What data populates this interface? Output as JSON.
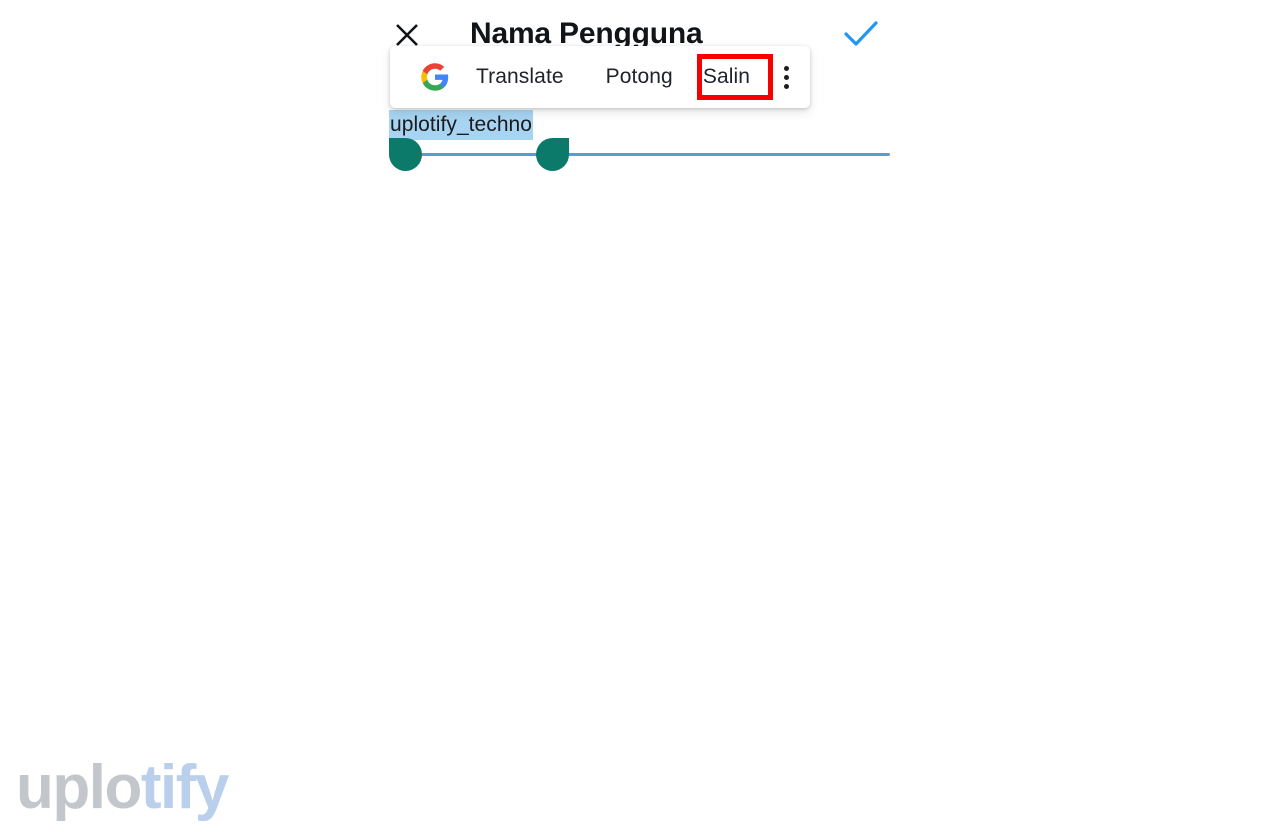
{
  "appbar": {
    "close_icon": "close-icon",
    "title": "Nama Pengguna",
    "confirm_icon": "check-icon",
    "confirm_color": "#2196f3"
  },
  "text_field": {
    "value": "uplotify_techno",
    "selected": true,
    "selection_highlight_color": "#a6d4f2",
    "underline_color": "#5b9bd5",
    "handle_color": "#0b7a6b",
    "handle_start_name": "selection-handle-start",
    "handle_end_name": "selection-handle-end"
  },
  "text_action_menu": {
    "google_icon": "google-g-icon",
    "items": [
      {
        "label": "Translate",
        "name": "menu-item-translate"
      },
      {
        "label": "Potong",
        "name": "menu-item-potong"
      },
      {
        "label": "Salin",
        "name": "menu-item-salin"
      }
    ],
    "overflow_icon": "more-vertical-icon",
    "highlighted_item": "Salin",
    "highlight_box_color": "#f70000"
  },
  "watermark": {
    "part_1": "uplo",
    "part_2": "tify",
    "part_1_color": "#c3c7cc",
    "part_2_color": "#b9cfeb"
  }
}
